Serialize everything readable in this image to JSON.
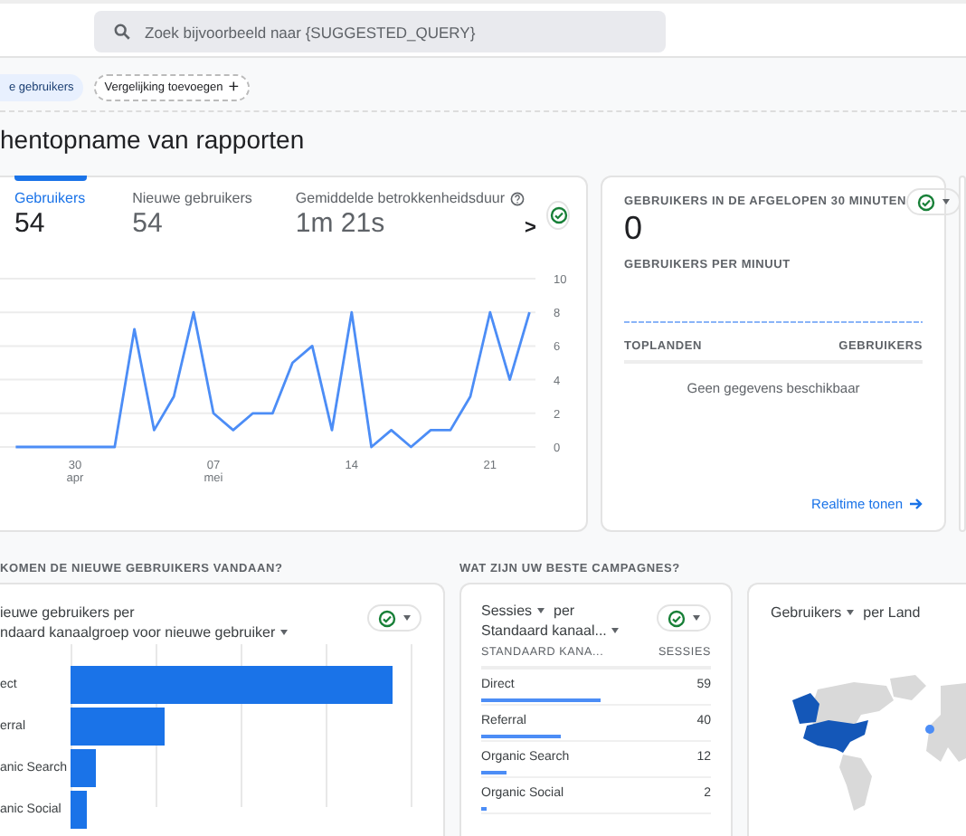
{
  "search": {
    "placeholder": "Zoek bijvoorbeeld naar {SUGGESTED_QUERY}"
  },
  "chips": [
    {
      "label": "e gebruikers",
      "kind": "segment"
    },
    {
      "label": "Vergelijking toevoegen",
      "icon": "+",
      "kind": "add"
    }
  ],
  "page_title": "hentopname van rapporten",
  "overview": {
    "tabs": [
      {
        "label": "Gebruikers",
        "value": "54",
        "selected": true,
        "help": false
      },
      {
        "label": "Nieuwe gebruikers",
        "value": "54",
        "selected": false,
        "help": false
      },
      {
        "label": "Gemiddelde betrokkenheidsduur",
        "value": "1m 21s",
        "selected": false,
        "help": true
      }
    ],
    "next": ">",
    "chart_data": {
      "type": "line",
      "x": [
        -3,
        -2,
        -1,
        0,
        1,
        2,
        3,
        4,
        5,
        6,
        7,
        8,
        9,
        10,
        11,
        12,
        13,
        14,
        15,
        16,
        17,
        18,
        19,
        20,
        21,
        22,
        23
      ],
      "grid": true,
      "series": [
        {
          "color": "#4c8df6",
          "values": [
            0,
            0,
            0,
            0,
            0,
            0,
            7,
            1,
            3,
            8,
            2,
            1,
            2,
            2,
            5,
            6,
            1,
            8,
            0,
            1,
            0,
            1,
            1,
            3,
            8,
            4,
            8
          ]
        }
      ],
      "xlim": [
        -3.8,
        23.3
      ],
      "ylim": [
        0,
        10
      ],
      "xticks": [
        {
          "value": 0,
          "label": "30 apr"
        },
        {
          "value": 7,
          "label": "07 mei"
        },
        {
          "value": 14,
          "label": "14"
        },
        {
          "value": 21,
          "label": "21"
        }
      ],
      "yticks": [
        0,
        2,
        4,
        6,
        8,
        10
      ]
    }
  },
  "realtime": {
    "title": "GEBRUIKERS IN DE AFGELOPEN 30 MINUTEN",
    "value": "0",
    "subtitle": "GEBRUIKERS PER MINUUT",
    "columns": [
      "TOPLANDEN",
      "GEBRUIKERS"
    ],
    "empty": "Geen gegevens beschikbaar",
    "link": "Realtime tonen"
  },
  "sections": [
    {
      "heading": "KOMEN DE NIEUWE GEBRUIKERS VANDAAN?"
    },
    {
      "heading": "WAT ZIJN UW BESTE CAMPAGNES?"
    }
  ],
  "new_users": {
    "title_1": "ieuwe gebruikers per",
    "title_2": "ndaard kanaalgroep voor nieuwe gebruiker",
    "categories": [
      "ect",
      "erral",
      "anic Search",
      "anic Social"
    ]
  },
  "campaigns": {
    "metric": "Sessies",
    "per": "per",
    "dimension": "Standaard kanaal...",
    "columns": [
      "STANDAARD KANA...",
      "SESSIES"
    ],
    "rows": [
      {
        "name": "Direct",
        "value": "59",
        "level": 0.52
      },
      {
        "name": "Referral",
        "value": "40",
        "level": 0.35
      },
      {
        "name": "Organic Search",
        "value": "12",
        "level": 0.11
      },
      {
        "name": "Organic Social",
        "value": "2",
        "level": 0.02
      }
    ]
  },
  "map": {
    "metric": "Gebruikers",
    "per": "per Land"
  }
}
